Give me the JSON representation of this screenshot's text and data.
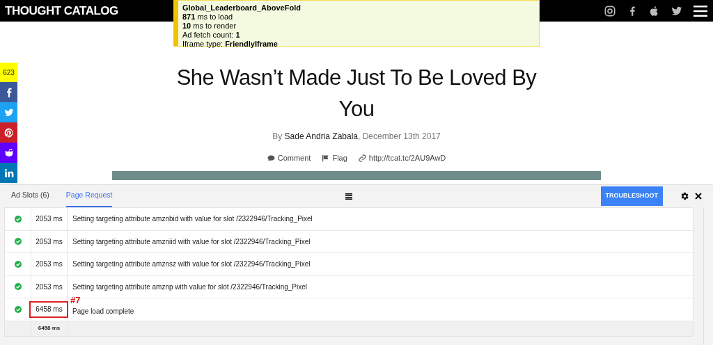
{
  "header": {
    "logo": "THOUGHT CATALOG",
    "social_icons": [
      {
        "kind": "instagram"
      },
      {
        "kind": "facebook"
      },
      {
        "kind": "apple"
      },
      {
        "kind": "twitter"
      }
    ]
  },
  "ad_overlay": {
    "slot": "Global_Leaderboard_AboveFold",
    "lines": [
      "**871** ms to load",
      "**10** ms to render",
      "Ad fetch count: **1**",
      "Iframe type: **FriendlyIframe**"
    ]
  },
  "share_bar": {
    "count": "623",
    "buttons": [
      {
        "kind": "facebook",
        "color": "#3b5998"
      },
      {
        "kind": "twitter",
        "color": "#1da1f2"
      },
      {
        "kind": "pinterest",
        "color": "#cb2027"
      },
      {
        "kind": "reddit",
        "color": "#5f00ff"
      },
      {
        "kind": "linkedin",
        "color": "#0077b5"
      }
    ]
  },
  "article": {
    "title": "She Wasn’t Made Just To Be Loved By You",
    "by": "By",
    "author": "Sade Andria Zabala",
    "date": ", December 13th 2017",
    "actions": [
      {
        "kind": "comment",
        "label": "Comment"
      },
      {
        "kind": "flag",
        "label": "Flag"
      },
      {
        "kind": "link",
        "label": "http://tcat.tc/2AU9AwD"
      }
    ]
  },
  "panel": {
    "tabs": [
      {
        "label": "Ad Slots (6)",
        "selected": false
      },
      {
        "label": "Page Request",
        "selected": true
      }
    ],
    "troubleshoot": "TROUBLESHOOT",
    "rows": [
      {
        "time": "2053 ms",
        "message": "Setting targeting attribute amznbid with value for slot /2322946/Tracking_Pixel"
      },
      {
        "time": "2053 ms",
        "message": "Setting targeting attribute amzniid with value for slot /2322946/Tracking_Pixel"
      },
      {
        "time": "2053 ms",
        "message": "Setting targeting attribute amznsz with value for slot /2322946/Tracking_Pixel"
      },
      {
        "time": "2053 ms",
        "message": "Setting targeting attribute amznp with value for slot /2322946/Tracking_Pixel"
      },
      {
        "time": "6458 ms",
        "message": "Page load complete",
        "annotation": "#7"
      }
    ],
    "total": "6458 ms"
  }
}
